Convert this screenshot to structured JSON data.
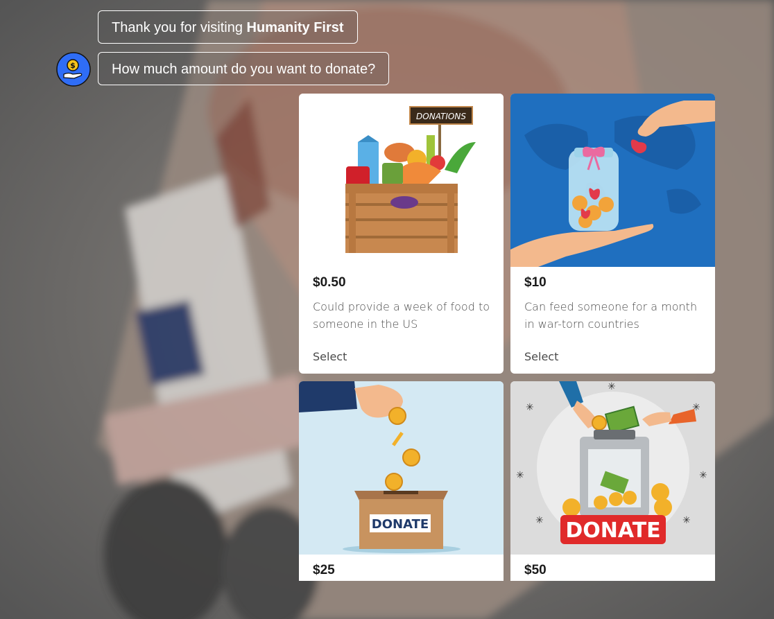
{
  "chat": {
    "greeting_prefix": "Thank you for visiting ",
    "greeting_brand": "Humanity First",
    "question": "How much amount do you want to donate?",
    "bot_avatar_icon": "donate-coin-hand-icon"
  },
  "options": [
    {
      "price": "$0.50",
      "description": "Could provide a week of food to someone in the US",
      "select_label": "Select",
      "image_icon": "food-donation-crate-icon",
      "image_sign_text": "DONATIONS"
    },
    {
      "price": "$10",
      "description": "Can feed someone for a month in war-torn countries",
      "select_label": "Select",
      "image_icon": "heart-jar-hands-icon"
    },
    {
      "price": "$25",
      "image_icon": "donate-box-coins-icon",
      "image_sign_text": "DONATE"
    },
    {
      "price": "$50",
      "image_icon": "donate-cash-box-icon",
      "image_sign_text": "DONATE"
    }
  ],
  "colors": {
    "card_background": "#ffffff",
    "bubble_border": "#ffffff",
    "avatar_blue": "#2f6df6",
    "map_blue": "#1f6fbf"
  }
}
